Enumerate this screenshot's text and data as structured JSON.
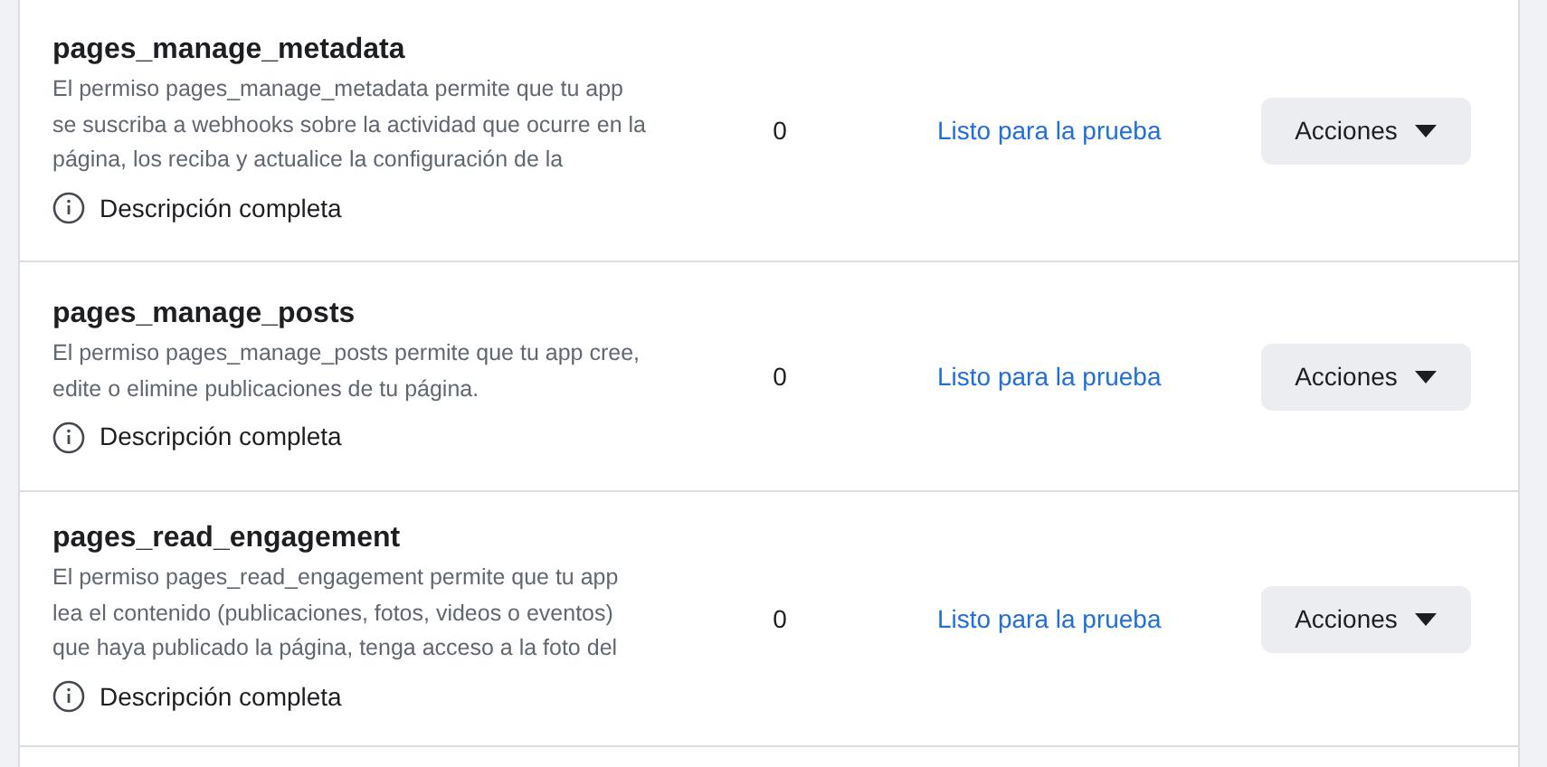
{
  "permissions": [
    {
      "name": "pages_manage_metadata",
      "description": "El permiso pages_manage_metadata permite que tu app se suscriba a webhooks sobre la actividad que ocurre en la página, los reciba y actualice la configuración de la",
      "details_link": "Descripción completa",
      "count": "0",
      "status": "Listo para la prueba",
      "actions": "Acciones"
    },
    {
      "name": "pages_manage_posts",
      "description": "El permiso pages_manage_posts permite que tu app cree, edite o elimine publicaciones de tu página.",
      "details_link": "Descripción completa",
      "count": "0",
      "status": "Listo para la prueba",
      "actions": "Acciones"
    },
    {
      "name": "pages_read_engagement",
      "description": "El permiso pages_read_engagement permite que tu app lea el contenido (publicaciones, fotos, videos o eventos) que haya publicado la página, tenga acceso a la foto del",
      "details_link": "Descripción completa",
      "count": "0",
      "status": "Listo para la prueba",
      "actions": "Acciones"
    }
  ]
}
